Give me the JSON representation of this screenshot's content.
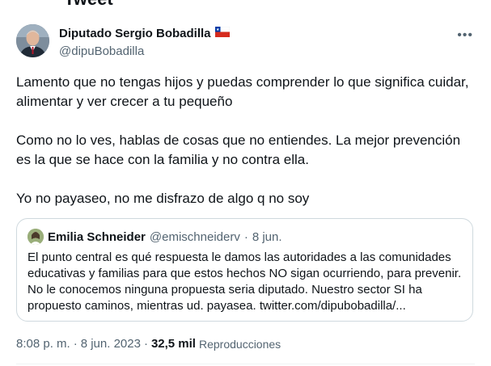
{
  "header": {
    "clipped_title": "Tweet"
  },
  "author": {
    "name": "Diputado Sergio Bobadilla",
    "handle": "@dipuBobadilla",
    "flag_icon": "chile-flag-icon"
  },
  "more_icon": "•••",
  "tweet": {
    "paragraphs": [
      "Lamento que no tengas hijos y puedas comprender lo que significa cuidar, alimentar y ver crecer a tu pequeño",
      "Como no lo ves, hablas de cosas que no entiendes. La mejor prevención es la que se hace con la familia y no contra ella.",
      "Yo no payaseo, no me disfrazo de algo q no soy"
    ]
  },
  "quote": {
    "name": "Emilia Schneider",
    "handle": "@emischneiderv",
    "separator": "·",
    "date": "8 jun.",
    "text": "El punto central es qué respuesta le damos las autoridades a las comunidades educativas y familias para que estos hechos NO sigan ocurriendo, para prevenir. No le conocemos ninguna propuesta seria diputado. Nuestro sector SI ha propuesto caminos, mientras ud. payasea. twitter.com/dipubobadilla/..."
  },
  "meta": {
    "time": "8:08 p. m.",
    "sep1": "·",
    "date": "8 jun. 2023",
    "sep2": "·",
    "views_count": "32,5 mil",
    "views_label": "Reproducciones"
  },
  "colors": {
    "text_primary": "#0f1419",
    "text_secondary": "#536471",
    "border": "#cfd9de"
  }
}
